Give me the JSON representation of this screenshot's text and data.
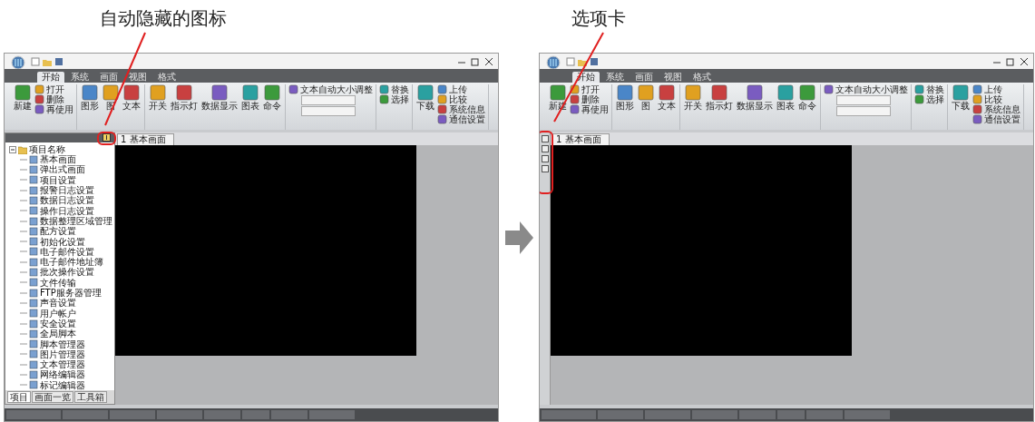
{
  "callouts": [
    {
      "text": "自动隐藏的图标"
    },
    {
      "text": "选项卡"
    }
  ],
  "screens": [
    {
      "side_panel": {
        "kind": "docked"
      },
      "ribbon_tabs": [
        {
          "label": "开始",
          "selected": true
        },
        {
          "label": "系统",
          "selected": false
        },
        {
          "label": "画面",
          "selected": false
        },
        {
          "label": "视图",
          "selected": false
        },
        {
          "label": "格式",
          "selected": false
        }
      ],
      "ribbon_groups": [
        {
          "items": [
            {
              "kind": "large",
              "label": "新建"
            },
            {
              "kind": "small",
              "label": "打开"
            },
            {
              "kind": "small",
              "label": "删除"
            },
            {
              "kind": "small",
              "label": "再使用"
            }
          ]
        },
        {
          "items": [
            {
              "kind": "large",
              "label": "图形"
            },
            {
              "kind": "large",
              "label": "图"
            },
            {
              "kind": "large",
              "label": "文本"
            }
          ]
        },
        {
          "items": [
            {
              "kind": "large",
              "label": "开关"
            },
            {
              "kind": "large",
              "label": "指示灯"
            },
            {
              "kind": "large",
              "label": "数据显示"
            },
            {
              "kind": "large",
              "label": "图表"
            },
            {
              "kind": "large",
              "label": "命令"
            }
          ]
        },
        {
          "items": [
            {
              "kind": "small",
              "label": "文本自动大小调整"
            },
            {
              "kind": "field"
            },
            {
              "kind": "field"
            }
          ]
        },
        {
          "items": [
            {
              "kind": "small",
              "label": "替换"
            },
            {
              "kind": "small",
              "label": "选择"
            }
          ]
        },
        {
          "items": [
            {
              "kind": "large",
              "label": "下载"
            },
            {
              "kind": "small",
              "label": "上传"
            },
            {
              "kind": "small",
              "label": "比较"
            },
            {
              "kind": "small",
              "label": "系统信息"
            },
            {
              "kind": "small",
              "label": "通信设置"
            }
          ]
        }
      ],
      "tree": [
        {
          "label": "项目名称",
          "children": [
            {
              "label": "基本画面"
            },
            {
              "label": "弹出式画面"
            },
            {
              "label": "项目设置"
            },
            {
              "label": "报警日志设置"
            },
            {
              "label": "数据日志设置"
            },
            {
              "label": "操作日志设置"
            },
            {
              "label": "数据整理区域管理"
            },
            {
              "label": "配方设置"
            },
            {
              "label": "初始化设置"
            },
            {
              "label": "电子邮件设置"
            },
            {
              "label": "电子邮件地址簿"
            },
            {
              "label": "批次操作设置"
            },
            {
              "label": "文件传输"
            },
            {
              "label": "FTP服务器管理"
            },
            {
              "label": "声音设置"
            },
            {
              "label": "用户帐户"
            },
            {
              "label": "安全设置"
            },
            {
              "label": "全局脚本"
            },
            {
              "label": "脚本管理器"
            },
            {
              "label": "图片管理器"
            },
            {
              "label": "文本管理器"
            },
            {
              "label": "网络编辑器"
            },
            {
              "label": "标记编辑器"
            }
          ]
        }
      ],
      "panel_tabs": [
        {
          "label": "项目",
          "selected": true
        },
        {
          "label": "画面一览",
          "selected": false
        },
        {
          "label": "工具箱",
          "selected": false
        }
      ],
      "doc_tab": "1 基本画面"
    },
    {
      "side_panel": {
        "kind": "collapsed"
      },
      "ribbon_tabs": [
        {
          "label": "开始",
          "selected": true
        },
        {
          "label": "系统",
          "selected": false
        },
        {
          "label": "画面",
          "selected": false
        },
        {
          "label": "视图",
          "selected": false
        },
        {
          "label": "格式",
          "selected": false
        }
      ],
      "ribbon_groups": [
        {
          "items": [
            {
              "kind": "large",
              "label": "新建"
            },
            {
              "kind": "small",
              "label": "打开"
            },
            {
              "kind": "small",
              "label": "删除"
            },
            {
              "kind": "small",
              "label": "再使用"
            }
          ]
        },
        {
          "items": [
            {
              "kind": "large",
              "label": "图形"
            },
            {
              "kind": "large",
              "label": "图"
            },
            {
              "kind": "large",
              "label": "文本"
            }
          ]
        },
        {
          "items": [
            {
              "kind": "large",
              "label": "开关"
            },
            {
              "kind": "large",
              "label": "指示灯"
            },
            {
              "kind": "large",
              "label": "数据显示"
            },
            {
              "kind": "large",
              "label": "图表"
            },
            {
              "kind": "large",
              "label": "命令"
            }
          ]
        },
        {
          "items": [
            {
              "kind": "small",
              "label": "文本自动大小调整"
            },
            {
              "kind": "field"
            },
            {
              "kind": "field"
            }
          ]
        },
        {
          "items": [
            {
              "kind": "small",
              "label": "替换"
            },
            {
              "kind": "small",
              "label": "选择"
            }
          ]
        },
        {
          "items": [
            {
              "kind": "large",
              "label": "下载"
            },
            {
              "kind": "small",
              "label": "上传"
            },
            {
              "kind": "small",
              "label": "比较"
            },
            {
              "kind": "small",
              "label": "系统信息"
            },
            {
              "kind": "small",
              "label": "通信设置"
            }
          ]
        }
      ],
      "doc_tab": "1 基本画面"
    }
  ]
}
